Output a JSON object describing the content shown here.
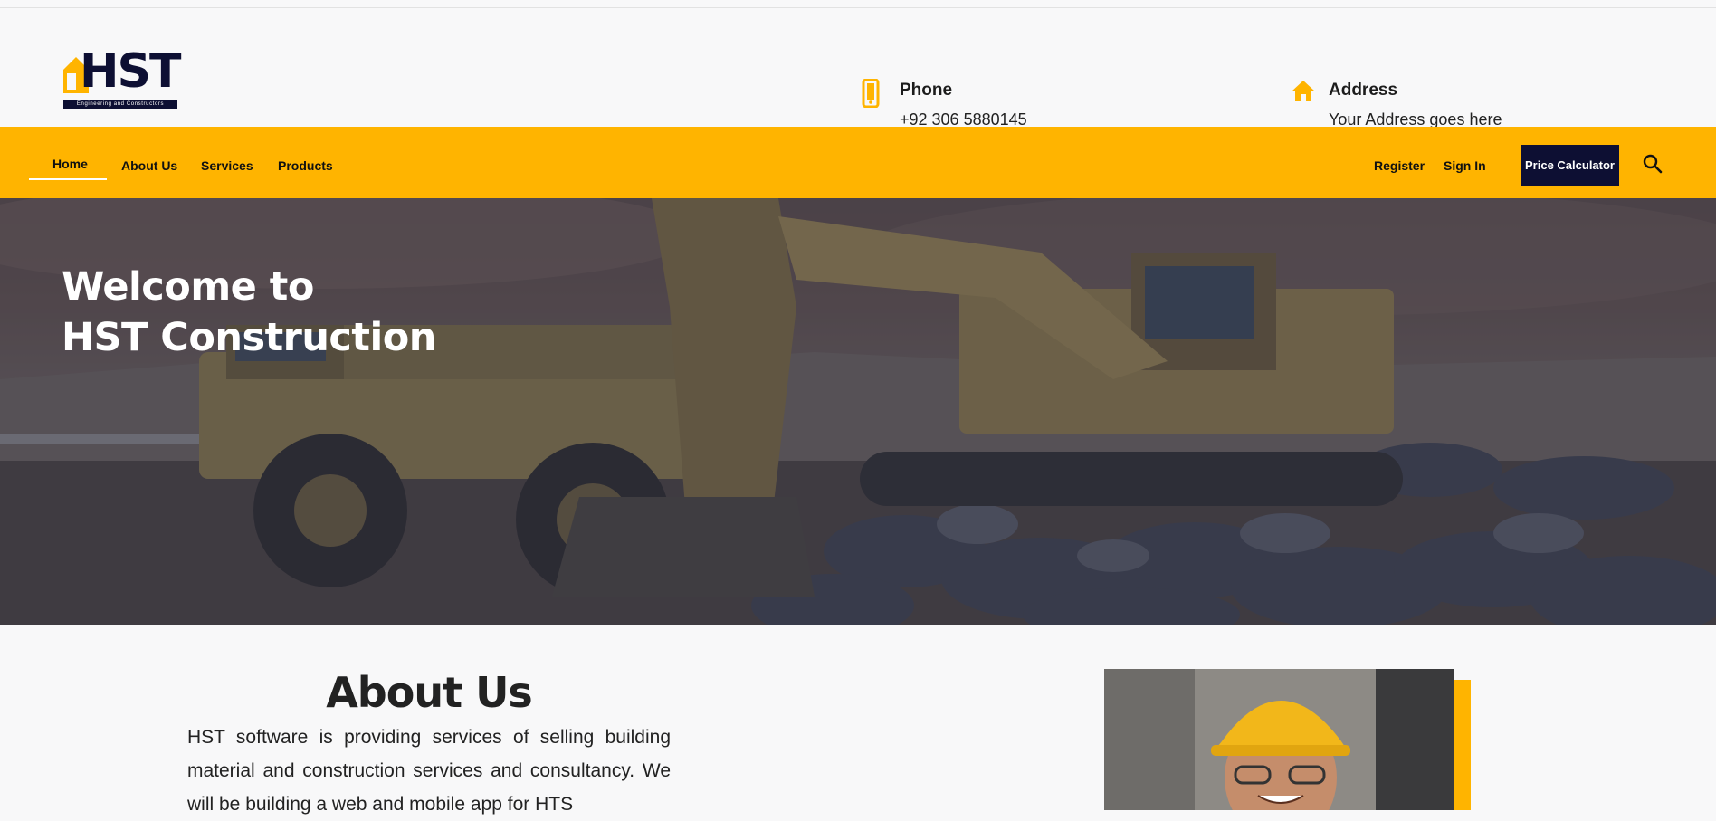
{
  "brand": {
    "logo_text": "HST",
    "logo_tagline": "Engineering and Constructors",
    "primary_color": "#ffb400",
    "dark_color": "#0d0f33"
  },
  "contact": {
    "phone": {
      "title": "Phone",
      "value": "+92 306 5880145",
      "icon": "mobile-phone-icon"
    },
    "address": {
      "title": "Address",
      "value": "Your Address goes here",
      "icon": "home-icon"
    }
  },
  "nav": {
    "items": [
      {
        "label": "Home",
        "active": true
      },
      {
        "label": "About Us"
      },
      {
        "label": "Services"
      },
      {
        "label": "Products"
      }
    ],
    "register": "Register",
    "sign_in": "Sign In",
    "price_calculator": "Price Calculator",
    "search_icon": "search-icon"
  },
  "hero": {
    "line1": "Welcome to",
    "line2": "HST Construction"
  },
  "about": {
    "title": "About Us",
    "text": "HST software is providing services of selling building material and construction services and consultancy. We will be building a web and mobile app for HTS"
  }
}
